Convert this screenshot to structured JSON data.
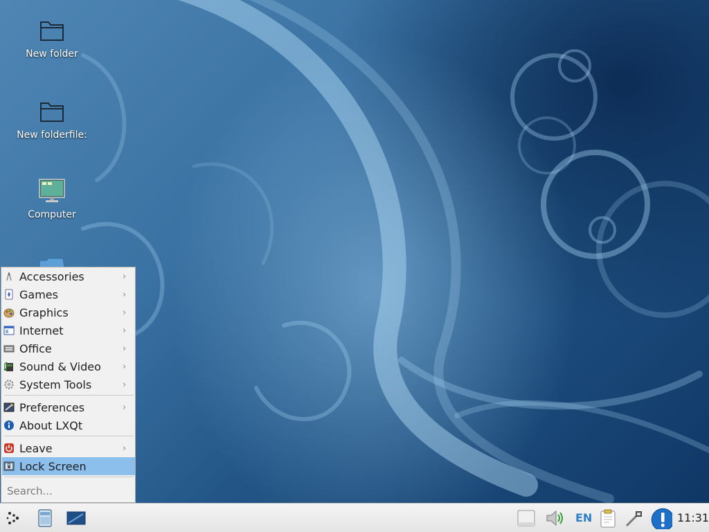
{
  "desktop": {
    "icons": [
      {
        "label": "New folder"
      },
      {
        "label": "New folderfile:"
      },
      {
        "label": "Computer"
      }
    ]
  },
  "menu": {
    "items": [
      {
        "label": "Accessories",
        "icon": "accessories-icon"
      },
      {
        "label": "Games",
        "icon": "games-icon"
      },
      {
        "label": "Graphics",
        "icon": "graphics-icon"
      },
      {
        "label": "Internet",
        "icon": "internet-icon"
      },
      {
        "label": "Office",
        "icon": "office-icon"
      },
      {
        "label": "Sound & Video",
        "icon": "sound-video-icon"
      },
      {
        "label": "System Tools",
        "icon": "system-tools-icon"
      },
      {
        "label": "Preferences",
        "icon": "preferences-icon"
      },
      {
        "label": "About LXQt",
        "icon": "info-icon"
      },
      {
        "label": "Leave",
        "icon": "power-icon"
      },
      {
        "label": "Lock Screen",
        "icon": "lock-screen-icon",
        "selected": true
      }
    ],
    "submenu_arrow": "›",
    "search_placeholder": "Search..."
  },
  "panel": {
    "language": "EN",
    "clock": "11:31"
  },
  "colors": {
    "menu_highlight": "#8cbfec",
    "language_text": "#2f7fc8",
    "notification_badge": "#1e6fc8"
  }
}
